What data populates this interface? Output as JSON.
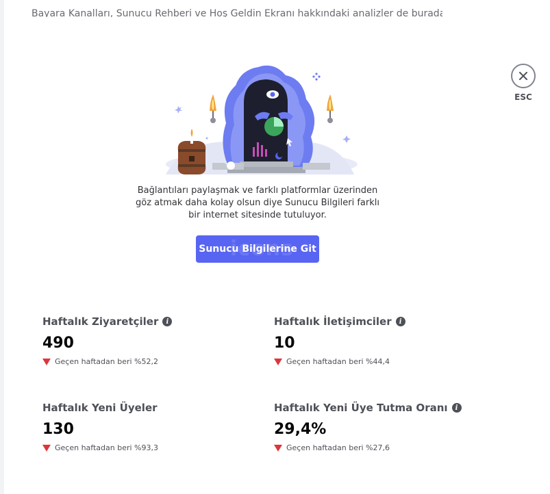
{
  "header": {
    "intro_text": "Bayara Kanalları, Sunucu Rehberi ve Hoş Geldin Ekranı hakkındaki analizler de burada yer alıyor."
  },
  "close": {
    "icon": "close-icon",
    "label": "ESC"
  },
  "promo": {
    "description": "Bağlantıları paylaşmak ve farklı platformlar üzerinden göz atmak daha kolay olsun diye Sunucu Bilgileri farklı bir internet sitesinde tutuluyor.",
    "button_label": "Sunucu Bilgilerine Git",
    "button_watermark": "icons",
    "button_color": "#5865f2"
  },
  "stats": [
    {
      "title": "Haftalık Ziyaretçiler",
      "has_info": true,
      "value": "490",
      "change": "Geçen haftadan beri %52,2",
      "trend": "down"
    },
    {
      "title": "Haftalık İletişimciler",
      "has_info": true,
      "value": "10",
      "change": "Geçen haftadan beri %44,4",
      "trend": "down"
    },
    {
      "title": "Haftalık Yeni Üyeler",
      "has_info": false,
      "value": "130",
      "change": "Geçen haftadan beri %93,3",
      "trend": "down"
    },
    {
      "title": "Haftalık Yeni Üye Tutma Oranı",
      "has_info": true,
      "value": "29,4%",
      "change": "Geçen haftadan beri %27,6",
      "trend": "down"
    }
  ],
  "colors": {
    "trend_down": "#da373c",
    "text_primary": "#060607",
    "text_secondary": "#4e5058"
  }
}
